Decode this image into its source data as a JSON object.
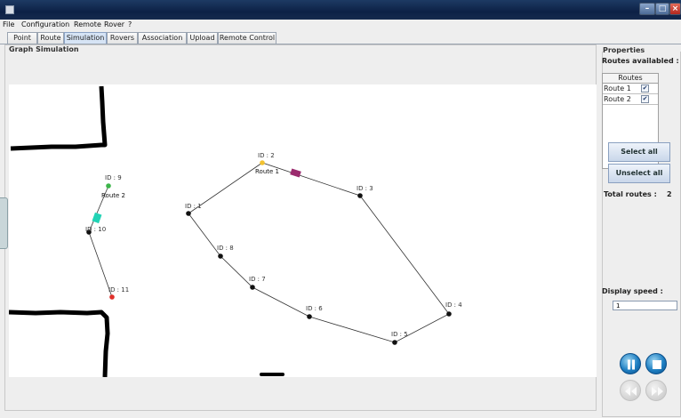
{
  "menu": {
    "items": [
      "File",
      "Configuration",
      "Remote",
      "Rover",
      "?"
    ]
  },
  "tabs": [
    {
      "label": "Point",
      "active": false
    },
    {
      "label": "Route",
      "active": false
    },
    {
      "label": "Simulation",
      "active": true
    },
    {
      "label": "Rovers",
      "active": false
    },
    {
      "label": "Association",
      "active": false
    },
    {
      "label": "Upload",
      "active": false
    },
    {
      "label": "Remote Control",
      "active": false
    }
  ],
  "simulation": {
    "panel_title": "Graph Simulation",
    "route_labels": [
      "Route 1",
      "Route 2"
    ],
    "nodes": [
      {
        "label": "ID : 1"
      },
      {
        "label": "ID : 2"
      },
      {
        "label": "ID : 3"
      },
      {
        "label": "ID : 4"
      },
      {
        "label": "ID : 5"
      },
      {
        "label": "ID : 6"
      },
      {
        "label": "ID : 7"
      },
      {
        "label": "ID : 8"
      },
      {
        "label": "ID : 9"
      },
      {
        "label": "ID : 10"
      },
      {
        "label": "ID : 11"
      }
    ],
    "colors": {
      "start_node": "#3cb54a",
      "end_node": "#e0302a",
      "node": "#111111",
      "rover_route1": "#9b2b6e",
      "rover_route2": "#22d3b5",
      "highlight_node": "#f2c230"
    }
  },
  "properties": {
    "title": "Properties",
    "routes_available_label": "Routes availabled :",
    "routes_column_header": "Routes",
    "routes": [
      {
        "name": "Route 1",
        "checked": true
      },
      {
        "name": "Route 2",
        "checked": true
      }
    ],
    "select_all_label": "Select all",
    "unselect_all_label": "Unselect all",
    "total_routes_label": "Total routes :",
    "total_routes_value": "2",
    "display_speed_label": "Display speed :",
    "display_speed_value": "1"
  },
  "controls": [
    {
      "icon": "pause-icon",
      "enabled": true
    },
    {
      "icon": "stop-icon",
      "enabled": true
    },
    {
      "icon": "rewind-icon",
      "enabled": false
    },
    {
      "icon": "fast-forward-icon",
      "enabled": false
    }
  ]
}
